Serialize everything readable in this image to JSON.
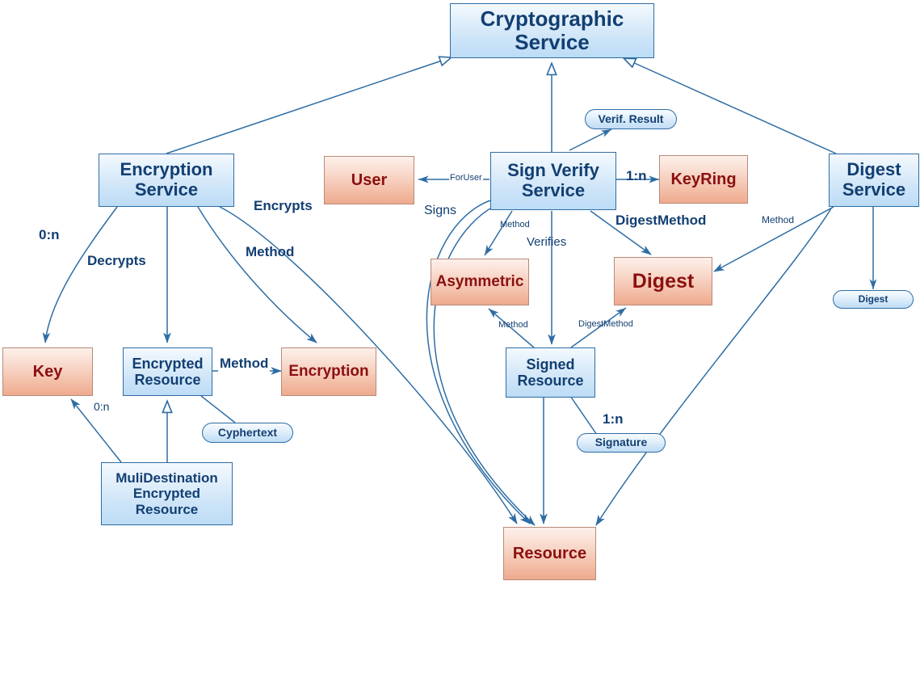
{
  "diagram": {
    "title": "Cryptographic Service Class Diagram",
    "colors": {
      "blue_fill_top": "#f4f9fe",
      "blue_fill_bottom": "#bcdcf6",
      "blue_border": "#2e6da4",
      "blue_text": "#123f72",
      "red_fill_top": "#fdf0ea",
      "red_fill_bottom": "#eeaa8e",
      "red_border": "#b88a7a",
      "red_text": "#8b1010",
      "edge": "#2e6da4",
      "background": "#ffffff"
    }
  },
  "nodes": {
    "cryptographic_service": {
      "label": "Cryptographic\nService",
      "line1": "Cryptographic",
      "line2": "Service",
      "shape": "rect",
      "style": "blue"
    },
    "encryption_service": {
      "line1": "Encryption",
      "line2": "Service",
      "shape": "rect",
      "style": "blue"
    },
    "sign_verify_service": {
      "line1": "Sign Verify",
      "line2": "Service",
      "shape": "rect",
      "style": "blue"
    },
    "digest_service": {
      "line1": "Digest",
      "line2": "Service",
      "shape": "rect",
      "style": "blue"
    },
    "user": {
      "label": "User",
      "shape": "rect",
      "style": "red"
    },
    "key_ring": {
      "label": "KeyRing",
      "shape": "rect",
      "style": "red"
    },
    "asymmetric": {
      "label": "Asymmetric",
      "shape": "rect",
      "style": "red"
    },
    "digest": {
      "label": "Digest",
      "shape": "rect",
      "style": "red"
    },
    "key": {
      "label": "Key",
      "shape": "rect",
      "style": "red"
    },
    "encryption": {
      "label": "Encryption",
      "shape": "rect",
      "style": "red"
    },
    "resource": {
      "label": "Resource",
      "shape": "rect",
      "style": "red"
    },
    "encrypted_resource": {
      "line1": "Encrypted",
      "line2": "Resource",
      "shape": "rect",
      "style": "blue"
    },
    "signed_resource": {
      "line1": "Signed",
      "line2": "Resource",
      "shape": "rect",
      "style": "blue"
    },
    "multi_destination_encrypted_resource": {
      "line1": "MuliDestination",
      "line2": "Encrypted",
      "line3": "Resource",
      "shape": "rect",
      "style": "blue"
    },
    "verif_result": {
      "label": "Verif. Result",
      "shape": "pill",
      "style": "blue"
    },
    "cyphertext": {
      "label": "Cyphertext",
      "shape": "pill",
      "style": "blue"
    },
    "signature": {
      "label": "Signature",
      "shape": "pill",
      "style": "blue"
    },
    "digest_pill": {
      "label": "Digest",
      "shape": "pill",
      "style": "blue"
    }
  },
  "edge_labels": {
    "zero_n_key": "0:n",
    "decrypts": "Decrypts",
    "encrypts": "Encrypts",
    "method_enc_service": "Method",
    "method_encrypted_resource": "Encryption",
    "method_er_to_encryption": "Method",
    "zero_n_multidest_key": "0:n",
    "for_user": "ForUser",
    "signs": "Signs",
    "verifies": "Verifies",
    "method_svs_asym": "Method",
    "digest_method_svs": "DigestMethod",
    "one_n_keyring": "1:n",
    "method_digest_service": "Method",
    "method_signed_asym": "Method",
    "digest_method_signed": "DigestMethod",
    "one_n_signature": "1:n"
  },
  "relationships": [
    {
      "from": "encryption_service",
      "to": "cryptographic_service",
      "type": "generalization",
      "label": ""
    },
    {
      "from": "sign_verify_service",
      "to": "cryptographic_service",
      "type": "generalization",
      "label": ""
    },
    {
      "from": "digest_service",
      "to": "cryptographic_service",
      "type": "generalization",
      "label": ""
    },
    {
      "from": "encryption_service",
      "to": "key",
      "type": "association",
      "label": "0:n"
    },
    {
      "from": "encryption_service",
      "to": "encrypted_resource",
      "type": "association",
      "label": "Decrypts"
    },
    {
      "from": "encryption_service",
      "to": "encryption",
      "type": "association",
      "label": "Method"
    },
    {
      "from": "encryption_service",
      "to": "resource",
      "type": "association",
      "label": "Encrypts"
    },
    {
      "from": "encrypted_resource",
      "to": "encryption",
      "type": "association",
      "label": "Method"
    },
    {
      "from": "encrypted_resource",
      "to": "cyphertext",
      "type": "attribute",
      "label": ""
    },
    {
      "from": "multi_destination_encrypted_resource",
      "to": "encrypted_resource",
      "type": "generalization",
      "label": ""
    },
    {
      "from": "multi_destination_encrypted_resource",
      "to": "key",
      "type": "association",
      "label": "0:n"
    },
    {
      "from": "sign_verify_service",
      "to": "user",
      "type": "association",
      "label": "ForUser"
    },
    {
      "from": "sign_verify_service",
      "to": "key_ring",
      "type": "association",
      "label": "1:n"
    },
    {
      "from": "sign_verify_service",
      "to": "verif_result",
      "type": "attribute",
      "label": ""
    },
    {
      "from": "sign_verify_service",
      "to": "asymmetric",
      "type": "association",
      "label": "Method"
    },
    {
      "from": "sign_verify_service",
      "to": "signed_resource",
      "type": "association",
      "label": "Verifies"
    },
    {
      "from": "sign_verify_service",
      "to": "digest",
      "type": "association",
      "label": "DigestMethod"
    },
    {
      "from": "sign_verify_service",
      "to": "resource",
      "type": "association",
      "label": "Signs"
    },
    {
      "from": "signed_resource",
      "to": "asymmetric",
      "type": "association",
      "label": "Method"
    },
    {
      "from": "signed_resource",
      "to": "digest",
      "type": "association",
      "label": "DigestMethod"
    },
    {
      "from": "signed_resource",
      "to": "signature",
      "type": "attribute",
      "label": "1:n"
    },
    {
      "from": "signed_resource",
      "to": "resource",
      "type": "association",
      "label": ""
    },
    {
      "from": "digest_service",
      "to": "digest",
      "type": "association",
      "label": "Method"
    },
    {
      "from": "digest_service",
      "to": "digest_pill",
      "type": "attribute",
      "label": ""
    },
    {
      "from": "digest_service",
      "to": "resource",
      "type": "association",
      "label": ""
    }
  ]
}
